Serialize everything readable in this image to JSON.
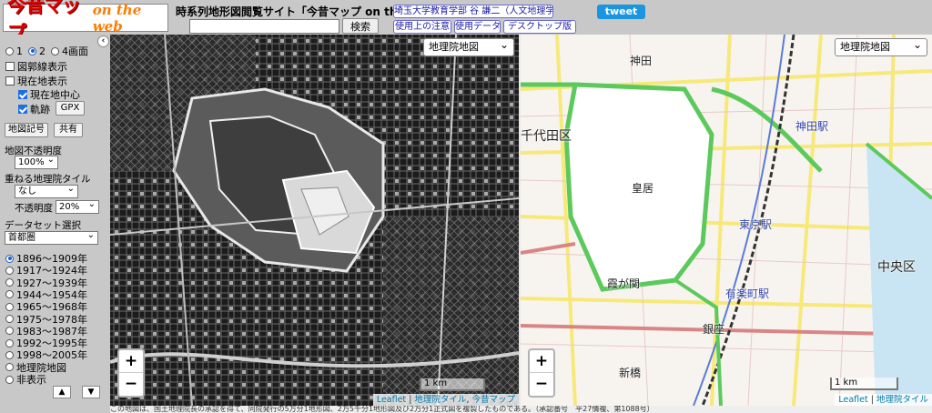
{
  "header": {
    "logo_main": "今昔マップ",
    "logo_sub": "on the web",
    "site_title": "時系列地形図閲覧サイト「今昔マップ on the web」",
    "search_placeholder": "",
    "search_button": "検索",
    "author_link": "埼玉大学教育学部 谷 謙二（人文地理学研究室）",
    "links": [
      "使用上の注意",
      "使用データ",
      "デスクトップ版"
    ],
    "tweet": "tweet"
  },
  "sidebar": {
    "screen_modes": [
      {
        "label": "1",
        "selected": false
      },
      {
        "label": "2",
        "selected": true
      },
      {
        "label": "4画面",
        "selected": false
      }
    ],
    "collapse_icon": "‹",
    "grid_toggle": {
      "label": "図郭線表示",
      "checked": false
    },
    "current_location": {
      "label": "現在地表示",
      "checked": false
    },
    "center_current": {
      "label": "現在地中心",
      "checked": true
    },
    "track": {
      "label": "軌跡",
      "checked": true
    },
    "gpx_button": "GPX",
    "map_symbols_button": "地図記号",
    "share_button": "共有",
    "opacity_label": "地図不透明度",
    "opacity_value": "100%",
    "overlay_label": "重ねる地理院タイル",
    "overlay_value": "なし",
    "overlay_opacity_label": "不透明度",
    "overlay_opacity_value": "20%",
    "dataset_label": "データセット選択",
    "dataset_value": "首都圏",
    "periods": [
      {
        "label": "1896〜1909年",
        "selected": true
      },
      {
        "label": "1917〜1924年",
        "selected": false
      },
      {
        "label": "1927〜1939年",
        "selected": false
      },
      {
        "label": "1944〜1954年",
        "selected": false
      },
      {
        "label": "1965〜1968年",
        "selected": false
      },
      {
        "label": "1975〜1978年",
        "selected": false
      },
      {
        "label": "1983〜1987年",
        "selected": false
      },
      {
        "label": "1992〜1995年",
        "selected": false
      },
      {
        "label": "1998〜2005年",
        "selected": false
      },
      {
        "label": "地理院地図",
        "selected": false
      },
      {
        "label": "非表示",
        "selected": false
      }
    ],
    "up_arrow": "▲",
    "down_arrow": "▼"
  },
  "map_left": {
    "layer_select": "地理院地図",
    "zoom_in": "+",
    "zoom_out": "−",
    "scale": "1 km",
    "attribution": [
      "Leaflet",
      "地理院タイル",
      "今昔マップ"
    ]
  },
  "map_right": {
    "layer_select": "地理院地図",
    "zoom_in": "+",
    "zoom_out": "−",
    "scale": "1 km",
    "attribution": [
      "Leaflet",
      "地理院タイル"
    ],
    "labels": {
      "chiyoda": "千代田区",
      "kokyo": "皇居",
      "tokyo_st": "東京駅",
      "kasumigaseki": "霞が関",
      "yurakucho": "有楽町駅",
      "ginza": "銀座",
      "shinbashi": "新橋",
      "chuo": "中央区",
      "kanda": "神田",
      "kanda_st": "神田駅"
    }
  },
  "footer": {
    "note": "この地図は、国土地理院長の承認を得て、同院発行の5万分1地形図、2万5千分1地形図及び2万分1正式図を複製したものである。（承認番号　平27情複、第1088号）"
  },
  "colors": {
    "accent": "#1f6fe0",
    "tweet": "#1b95e0",
    "logo_red": "#e60000",
    "road_yellow": "#f3e84c",
    "road_green": "#5cc95c",
    "road_pink": "#d98585",
    "palace": "#ffffff"
  }
}
